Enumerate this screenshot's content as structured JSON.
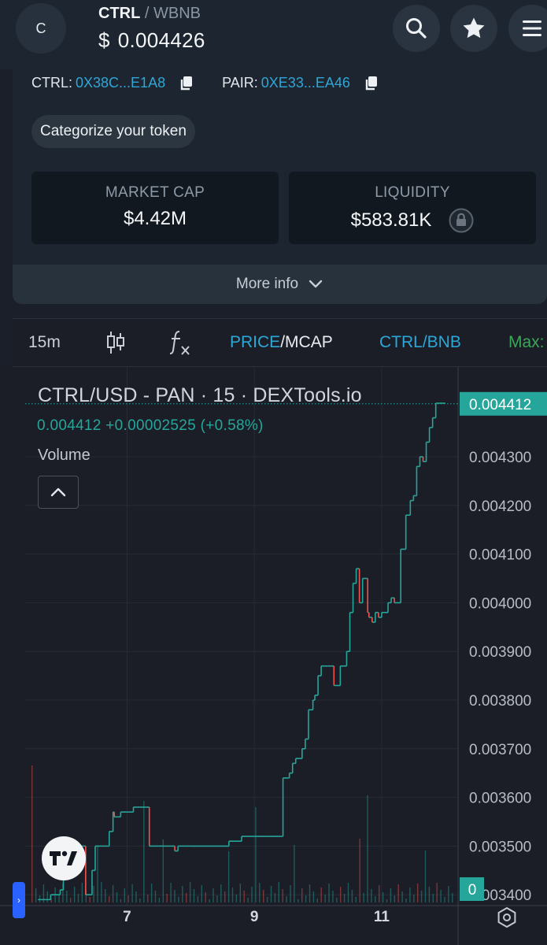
{
  "header": {
    "avatar_letter": "C",
    "base_symbol": "CTRL",
    "separator": "/",
    "quote_symbol": "WBNB",
    "currency": "$",
    "price": "0.004426",
    "icons": [
      "search-icon",
      "star-icon",
      "menu-icon"
    ]
  },
  "addresses": {
    "token_label": "CTRL:",
    "token_address": "0X38C...E1A8",
    "pair_label": "PAIR:",
    "pair_address": "0XE33...EA46"
  },
  "categorize_label": "Categorize your token",
  "stats": {
    "market_cap_label": "MARKET CAP",
    "market_cap_value": "$4.42M",
    "liquidity_label": "LIQUIDITY",
    "liquidity_value": "$583.81K"
  },
  "more_info_label": "More info",
  "toolbar": {
    "interval": "15m",
    "price_label": "PRICE",
    "mcap_label": "MCAP",
    "pair_label": "CTRL/BNB",
    "max_label": "Max:"
  },
  "chart": {
    "title": "CTRL/USD - PAN · 15 · DEXTools.io",
    "last_price": "0.004412",
    "change": "+0.00002525",
    "change_pct": "(+0.58%)",
    "volume_label": "Volume",
    "volume_badge": "0",
    "colors": {
      "up": "#26a69a",
      "down": "#ef5350",
      "price_tag": "#26a69a",
      "background": "#1b1e27"
    }
  },
  "chart_data": {
    "type": "line",
    "title": "CTRL/USD - PAN · 15 · DEXTools.io",
    "x_ticks": [
      "7",
      "9",
      "11"
    ],
    "y_ticks": [
      "0.004300",
      "0.004200",
      "0.004100",
      "0.004000",
      "0.003900",
      "0.003800",
      "0.003700",
      "0.003600",
      "0.003500",
      "0.003400"
    ],
    "ylim": [
      0.00338,
      0.00444
    ],
    "xlim": [
      5.4,
      12.2
    ],
    "series": [
      {
        "x": [
          5.6,
          5.8,
          5.95,
          6.0,
          6.1,
          6.15,
          6.3,
          6.35,
          6.45,
          6.5,
          6.62,
          6.7,
          6.72,
          6.78,
          6.8,
          6.9,
          7.0,
          7.1,
          7.2,
          7.3,
          7.35,
          7.45,
          7.5,
          7.6,
          7.75,
          7.8,
          7.9,
          8.0,
          8.2,
          8.4,
          8.6,
          8.8,
          8.9,
          9.0,
          9.2,
          9.4,
          9.45,
          9.55,
          9.6,
          9.65,
          9.75,
          9.8,
          9.85,
          9.92,
          9.95,
          10.0,
          10.05,
          10.15,
          10.2,
          10.25,
          10.35,
          10.45,
          10.5,
          10.55,
          10.6,
          10.65,
          10.7,
          10.78,
          10.8,
          10.85,
          10.9,
          10.95,
          11.0,
          11.05,
          11.1,
          11.15,
          11.2,
          11.3,
          11.38,
          11.45,
          11.5,
          11.55,
          11.6,
          11.65,
          11.7,
          11.75,
          11.8,
          11.85,
          11.9,
          11.95,
          12.0
        ],
        "y": [
          0.00339,
          0.0034,
          0.00341,
          0.00345,
          0.00348,
          0.0035,
          0.0035,
          0.0034,
          0.00345,
          0.0035,
          0.0035,
          0.0035,
          0.00353,
          0.00357,
          0.00356,
          0.00357,
          0.00357,
          0.00358,
          0.00358,
          0.00358,
          0.0035,
          0.0035,
          0.0035,
          0.0035,
          0.00349,
          0.0035,
          0.0035,
          0.0035,
          0.0035,
          0.0035,
          0.00351,
          0.00352,
          0.00352,
          0.00352,
          0.00352,
          0.00352,
          0.00364,
          0.00365,
          0.00367,
          0.00368,
          0.0037,
          0.00372,
          0.00378,
          0.0038,
          0.00381,
          0.00385,
          0.00387,
          0.00387,
          0.00387,
          0.00383,
          0.00387,
          0.0039,
          0.00398,
          0.00404,
          0.00407,
          0.004,
          0.00405,
          0.00398,
          0.00397,
          0.00396,
          0.00398,
          0.00397,
          0.00398,
          0.00398,
          0.004,
          0.00401,
          0.004,
          0.00411,
          0.00418,
          0.00421,
          0.00422,
          0.00428,
          0.0043,
          0.00429,
          0.00433,
          0.00436,
          0.00438,
          0.00441,
          0.00441,
          0.00441,
          0.00441
        ]
      }
    ],
    "grid": true
  }
}
